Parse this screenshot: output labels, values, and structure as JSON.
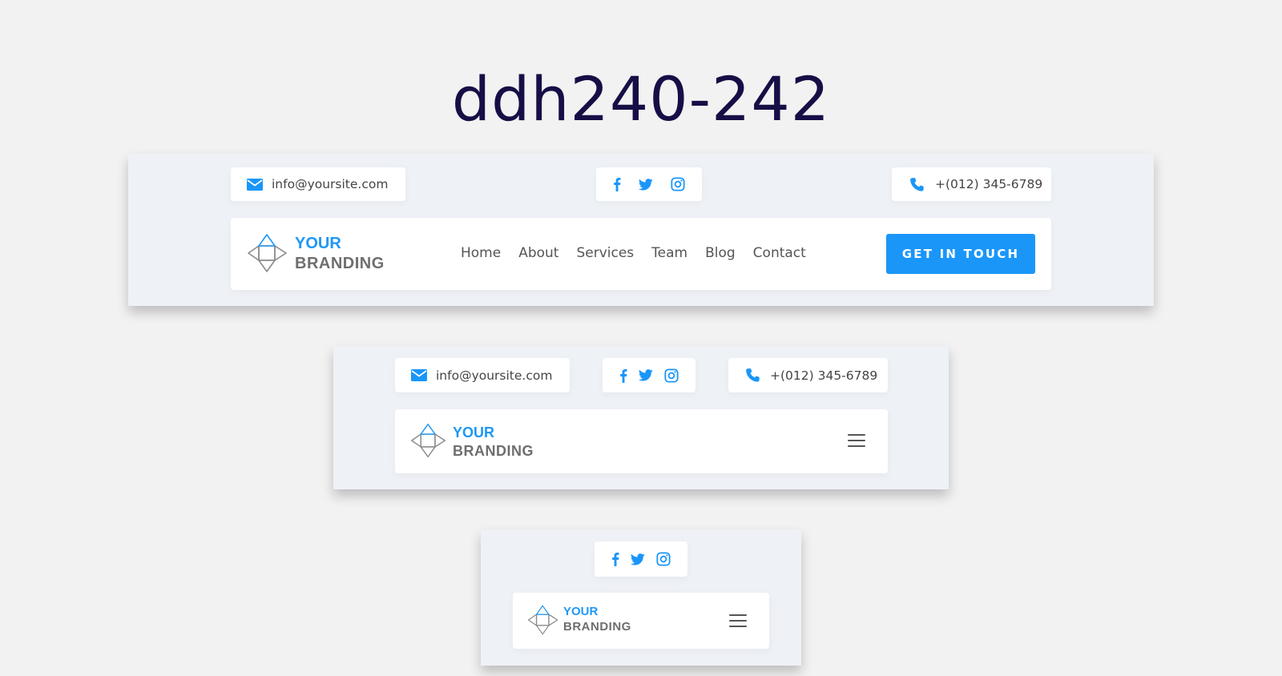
{
  "page": {
    "title": "ddh240-242"
  },
  "contact": {
    "email": "info@yoursite.com",
    "phone": "+(012) 345-6789"
  },
  "brand": {
    "line1": "YOUR",
    "line2": "BRANDING"
  },
  "nav": {
    "items": [
      "Home",
      "About",
      "Services",
      "Team",
      "Blog",
      "Contact"
    ],
    "cta_label": "GET IN TOUCH"
  },
  "icons": {
    "email": "envelope-icon",
    "phone": "phone-icon",
    "social": [
      "facebook-icon",
      "twitter-icon",
      "instagram-icon"
    ],
    "menu": "hamburger-menu-icon"
  },
  "colors": {
    "accent": "#1a96f9",
    "title": "#160f46",
    "panel_bg": "#eef1f6",
    "page_bg": "#f2f2f2",
    "card_bg": "#ffffff"
  }
}
